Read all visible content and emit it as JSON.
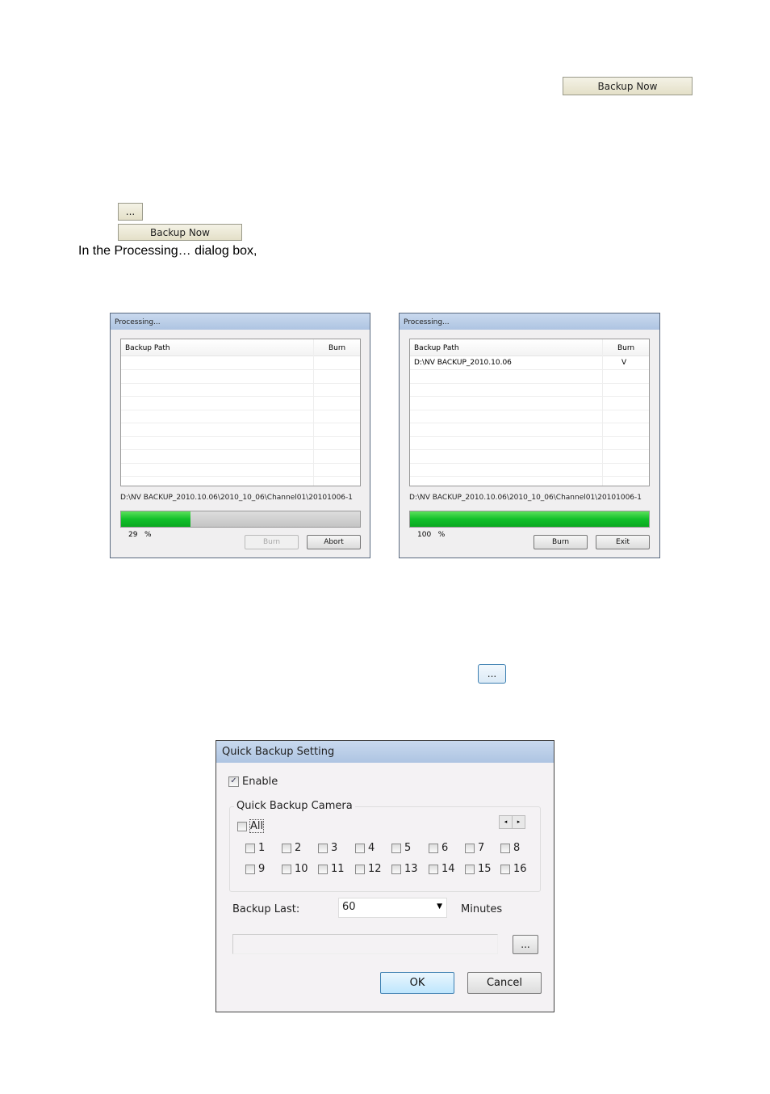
{
  "top": {
    "backup_now_1": "Backup Now",
    "browse_1": "...",
    "backup_now_2": "Backup Now",
    "caption": "In the Processing… dialog box,",
    "browse_2": "..."
  },
  "processing_dialogs": [
    {
      "title": "Processing...",
      "columns": [
        "Backup Path",
        "Burn"
      ],
      "rows": [],
      "current_path": "D:\\NV BACKUP_2010.10.06\\2010_10_06\\Channel01\\20101006-1",
      "progress_percent": 29,
      "progress_label": "29",
      "percent_sign": "%",
      "buttons": [
        {
          "label": "Burn",
          "enabled": false
        },
        {
          "label": "Abort",
          "enabled": true
        }
      ]
    },
    {
      "title": "Processing...",
      "columns": [
        "Backup Path",
        "Burn"
      ],
      "rows": [
        {
          "path": "D:\\NV BACKUP_2010.10.06",
          "burn": "V"
        }
      ],
      "current_path": "D:\\NV BACKUP_2010.10.06\\2010_10_06\\Channel01\\20101006-1",
      "progress_percent": 100,
      "progress_label": "100",
      "percent_sign": "%",
      "buttons": [
        {
          "label": "Burn",
          "enabled": true
        },
        {
          "label": "Exit",
          "enabled": true
        }
      ]
    }
  ],
  "quick_backup": {
    "title": "Quick Backup Setting",
    "enable_label": "Enable",
    "enable_checked": true,
    "group_label": "Quick Backup Camera",
    "all_label": "All",
    "cameras": [
      "1",
      "2",
      "3",
      "4",
      "5",
      "6",
      "7",
      "8",
      "9",
      "10",
      "11",
      "12",
      "13",
      "14",
      "15",
      "16"
    ],
    "backup_last_label": "Backup Last:",
    "backup_last_value": "60",
    "minutes_label": "Minutes",
    "path_value": "",
    "browse_label": "...",
    "ok_label": "OK",
    "cancel_label": "Cancel"
  },
  "colors": {
    "progress_green": "#12c02a",
    "title_bar": "#b8cce6"
  }
}
